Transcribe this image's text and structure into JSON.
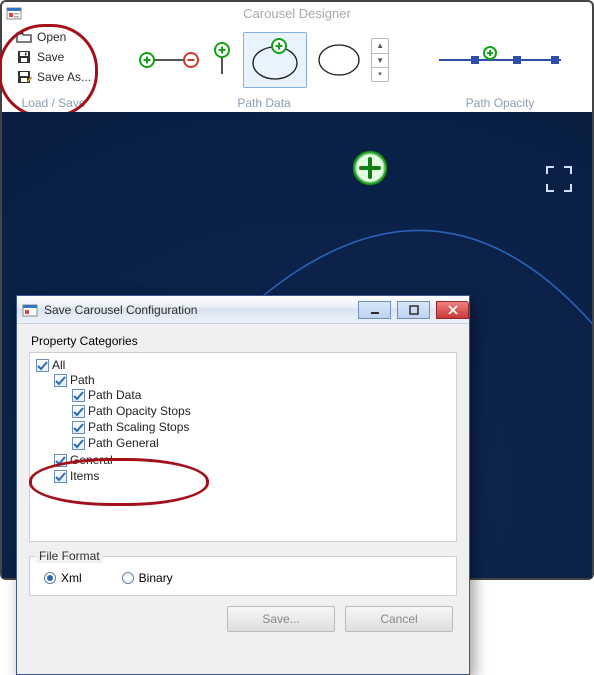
{
  "app": {
    "title": "Carousel Designer"
  },
  "ribbon": {
    "load_save": {
      "caption": "Load / Save",
      "items": {
        "open": "Open",
        "save": "Save",
        "save_as": "Save As..."
      }
    },
    "path_data": {
      "caption": "Path Data"
    },
    "path_opacity": {
      "caption": "Path Opacity"
    }
  },
  "dialog": {
    "title": "Save Carousel Configuration",
    "prop_categories_label": "Property Categories",
    "tree": {
      "all": "All",
      "path": "Path",
      "path_data": "Path Data",
      "path_opacity": "Path Opacity Stops",
      "path_scaling": "Path Scaling Stops",
      "path_general": "Path General",
      "general": "General",
      "items": "Items"
    },
    "file_format": {
      "label": "File Format",
      "xml": "Xml",
      "binary": "Binary",
      "selected": "xml"
    },
    "buttons": {
      "save": "Save...",
      "cancel": "Cancel"
    }
  }
}
